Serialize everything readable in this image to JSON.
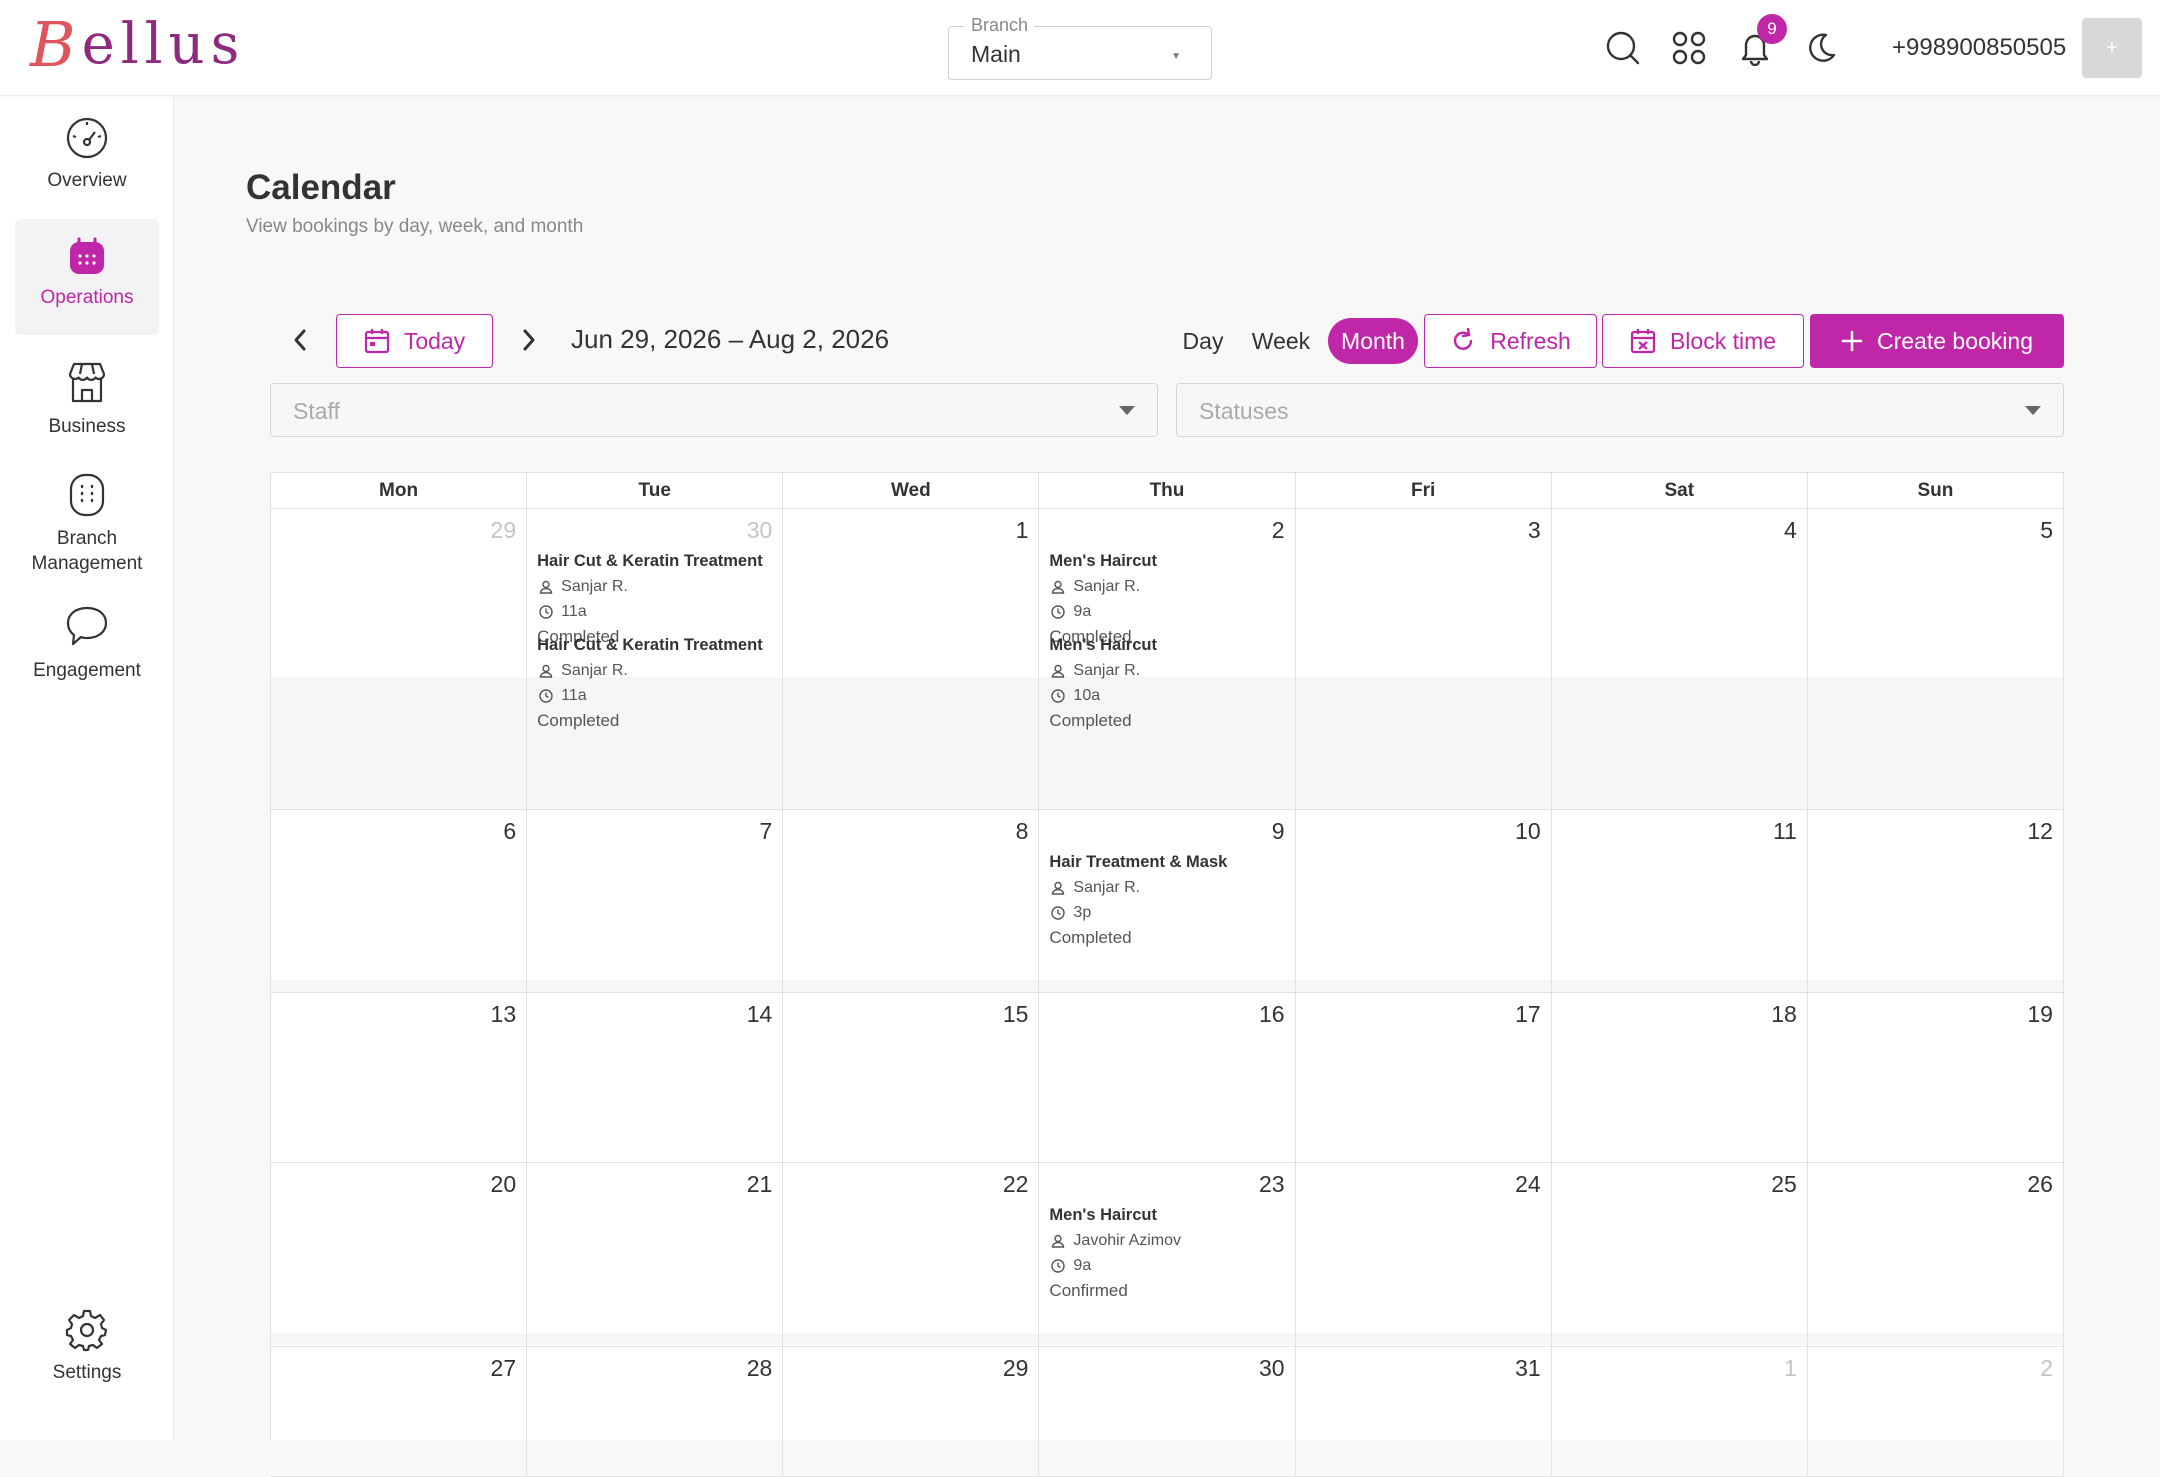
{
  "app": {
    "logo_text": "Bellus"
  },
  "header": {
    "branch_label": "Branch",
    "branch_value": "Main",
    "notification_count": "9",
    "phone": "+998900850505",
    "avatar_text": "+",
    "icons": [
      "search-icon",
      "apps-grid-icon",
      "bell-icon",
      "moon-icon"
    ]
  },
  "sidebar": {
    "items": [
      {
        "label": "Overview",
        "icon": "speedometer-icon",
        "active": false
      },
      {
        "label": "Operations",
        "icon": "calendar-icon",
        "active": true
      },
      {
        "label": "Business",
        "icon": "shop-icon",
        "active": false
      },
      {
        "label": "Branch Management",
        "icon": "building-icon",
        "active": false
      },
      {
        "label": "Engagement",
        "icon": "chat-bubble-icon",
        "active": false
      },
      {
        "label": "Settings",
        "icon": "gear-icon",
        "active": false
      }
    ]
  },
  "page": {
    "title": "Calendar",
    "subtitle": "View bookings by day, week, and month"
  },
  "toolbar": {
    "today_label": "Today",
    "range": "Jun 29, 2026 – Aug 2, 2026",
    "views": [
      "Day",
      "Week",
      "Month"
    ],
    "active_view": "Month",
    "refresh_label": "Refresh",
    "block_label": "Block time",
    "create_label": "Create booking",
    "staff_placeholder": "Staff",
    "statuses_placeholder": "Statuses"
  },
  "calendar": {
    "weekdays": [
      "Mon",
      "Tue",
      "Wed",
      "Thu",
      "Fri",
      "Sat",
      "Sun"
    ],
    "weeks": [
      {
        "days": [
          {
            "num": "29",
            "other": true,
            "events": []
          },
          {
            "num": "30",
            "other": true,
            "events": [
              {
                "title": "Hair Cut & Keratin Treatment",
                "staff": "Sanjar R.",
                "time": "11a",
                "status": "Completed"
              },
              {
                "title": "Hair Cut & Keratin Treatment",
                "staff": "Sanjar R.",
                "time": "11a",
                "status": "Completed"
              }
            ]
          },
          {
            "num": "1",
            "other": false,
            "events": []
          },
          {
            "num": "2",
            "other": false,
            "events": [
              {
                "title": "Men's Haircut",
                "staff": "Sanjar R.",
                "time": "9a",
                "status": "Completed"
              },
              {
                "title": "Men's Haircut",
                "staff": "Sanjar R.",
                "time": "10a",
                "status": "Completed"
              }
            ]
          },
          {
            "num": "3",
            "other": false,
            "events": []
          },
          {
            "num": "4",
            "other": false,
            "events": []
          },
          {
            "num": "5",
            "other": false,
            "events": []
          }
        ]
      },
      {
        "days": [
          {
            "num": "6",
            "other": false,
            "events": []
          },
          {
            "num": "7",
            "other": false,
            "events": []
          },
          {
            "num": "8",
            "other": false,
            "events": []
          },
          {
            "num": "9",
            "other": false,
            "events": [
              {
                "title": "Hair Treatment & Mask",
                "staff": "Sanjar R.",
                "time": "3p",
                "status": "Completed"
              }
            ]
          },
          {
            "num": "10",
            "other": false,
            "events": []
          },
          {
            "num": "11",
            "other": false,
            "events": []
          },
          {
            "num": "12",
            "other": false,
            "events": []
          }
        ]
      },
      {
        "days": [
          {
            "num": "13",
            "other": false,
            "events": []
          },
          {
            "num": "14",
            "other": false,
            "events": []
          },
          {
            "num": "15",
            "other": false,
            "events": []
          },
          {
            "num": "16",
            "other": false,
            "events": []
          },
          {
            "num": "17",
            "other": false,
            "events": []
          },
          {
            "num": "18",
            "other": false,
            "events": []
          },
          {
            "num": "19",
            "other": false,
            "events": []
          }
        ]
      },
      {
        "days": [
          {
            "num": "20",
            "other": false,
            "events": []
          },
          {
            "num": "21",
            "other": false,
            "events": []
          },
          {
            "num": "22",
            "other": false,
            "events": []
          },
          {
            "num": "23",
            "other": false,
            "events": [
              {
                "title": "Men's Haircut",
                "staff": "Javohir Azimov",
                "time": "9a",
                "status": "Confirmed"
              }
            ]
          },
          {
            "num": "24",
            "other": false,
            "events": []
          },
          {
            "num": "25",
            "other": false,
            "events": []
          },
          {
            "num": "26",
            "other": false,
            "events": []
          }
        ]
      },
      {
        "days": [
          {
            "num": "27",
            "other": false,
            "events": []
          },
          {
            "num": "28",
            "other": false,
            "events": []
          },
          {
            "num": "29",
            "other": false,
            "events": []
          },
          {
            "num": "30",
            "other": false,
            "events": []
          },
          {
            "num": "31",
            "other": false,
            "events": []
          },
          {
            "num": "1",
            "other": true,
            "events": []
          },
          {
            "num": "2",
            "other": true,
            "events": []
          }
        ]
      }
    ]
  },
  "colors": {
    "accent": "#c026a8",
    "logo": "#8e2a7f",
    "logo_initial": "#e0555d"
  }
}
